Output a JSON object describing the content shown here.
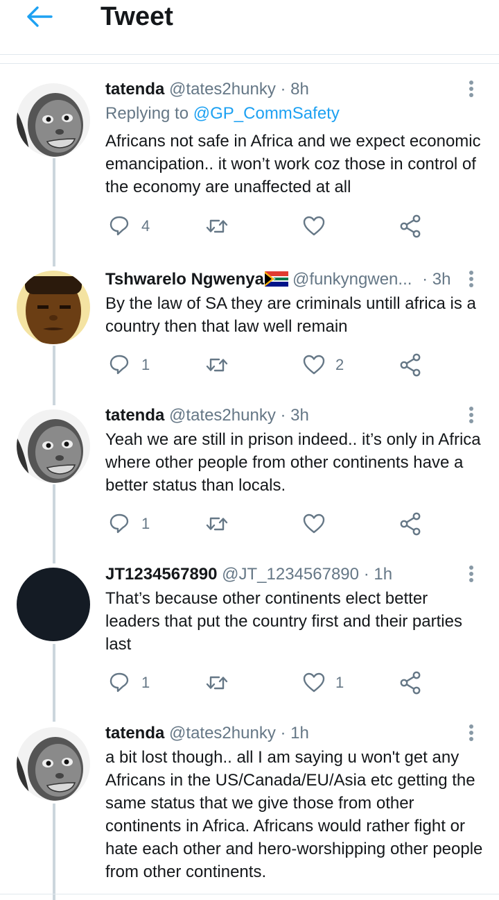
{
  "header": {
    "title": "Tweet",
    "back_icon": "arrow-left-icon",
    "accent": "#1da1f2"
  },
  "tweets": [
    {
      "name": "tatenda",
      "handle": "@tates2hunky",
      "time": "· 8h",
      "replying_prefix": "Replying to ",
      "replying_to": "@GP_CommSafety",
      "text": "Africans not safe in Africa and we expect economic emancipation.. it won’t work coz those in control of the economy are unaffected at all",
      "replies": "4",
      "retweets": "",
      "likes": ""
    },
    {
      "name": "Tshwarelo Ngwenya",
      "flag": "south-africa-flag-icon",
      "handle": "@funkyngwen...",
      "time": "· 3h",
      "text": "By the law of SA they are criminals untill africa is a country then that law well remain",
      "replies": "1",
      "retweets": "",
      "likes": "2"
    },
    {
      "name": "tatenda",
      "handle": "@tates2hunky",
      "time": "· 3h",
      "text": "Yeah we are still in prison indeed.. it’s only in Africa where other people from other continents have a better status than locals.",
      "replies": "1",
      "retweets": "",
      "likes": ""
    },
    {
      "name": "JT1234567890",
      "handle": "@JT_1234567890",
      "time": "· 1h",
      "text": "That’s because other continents elect better leaders that put the country first and their parties last",
      "replies": "1",
      "retweets": "",
      "likes": "1"
    },
    {
      "name": "tatenda",
      "handle": "@tates2hunky",
      "time": "· 1h",
      "text": "a bit lost though.. all I am saying u won't get any Africans in the US/Canada/EU/Asia etc getting the same status that we give those from other continents in Africa. Africans would rather fight or hate each other and hero-worshipping other people from other continents."
    }
  ]
}
